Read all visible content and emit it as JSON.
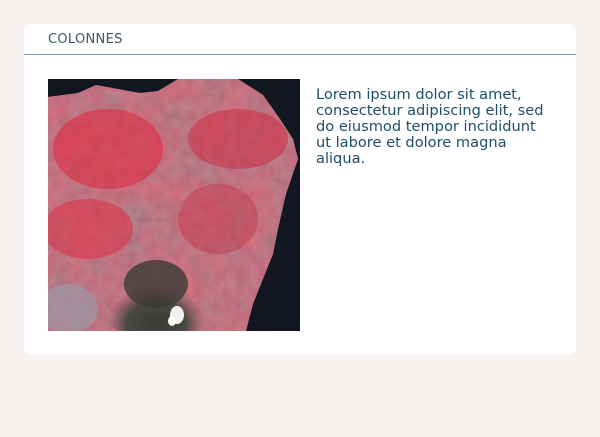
{
  "card": {
    "title": "COLONNES"
  },
  "content": {
    "image_alt": "Satellite false-color image",
    "paragraph": "Lorem ipsum dolor sit amet, consectetur adipiscing elit, sed do eiusmod tempor incididunt ut labore et dolore magna aliqua."
  },
  "colors": {
    "page_background": "#f8f3f0",
    "card_background": "#ffffff",
    "header_divider": "#7f9aa5",
    "title_text": "#3d5563",
    "body_text": "#1f4f68"
  }
}
